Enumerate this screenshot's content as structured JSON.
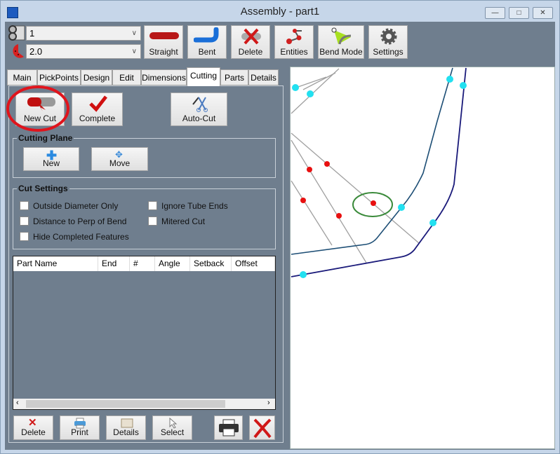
{
  "window": {
    "title": "Assembly - part1",
    "minimize": "—",
    "restore": "□",
    "close": "✕"
  },
  "toolbar": {
    "tube_select": {
      "value": "1"
    },
    "radius_select": {
      "value": "2.0"
    },
    "buttons": [
      {
        "label": "Straight",
        "icon": "straight-tube-icon"
      },
      {
        "label": "Bent",
        "icon": "bent-tube-icon"
      },
      {
        "label": "Delete",
        "icon": "delete-tube-icon"
      },
      {
        "label": "Entities",
        "icon": "entities-icon"
      },
      {
        "label": "Bend Mode",
        "icon": "bend-mode-icon"
      },
      {
        "label": "Settings",
        "icon": "gear-icon"
      }
    ]
  },
  "tabs": [
    {
      "label": "Main"
    },
    {
      "label": "PickPoints"
    },
    {
      "label": "Design"
    },
    {
      "label": "Edit"
    },
    {
      "label": "Dimensions"
    },
    {
      "label": "Cutting",
      "active": true
    },
    {
      "label": "Parts"
    },
    {
      "label": "Details"
    }
  ],
  "cutting": {
    "new_cut": "New Cut",
    "complete": "Complete",
    "auto_cut": "Auto-Cut",
    "cutting_plane": {
      "title": "Cutting Plane",
      "new": "New",
      "move": "Move"
    },
    "cut_settings": {
      "title": "Cut Settings",
      "options": [
        {
          "label": "Outside Diameter Only",
          "checked": false
        },
        {
          "label": "Ignore Tube Ends",
          "checked": false
        },
        {
          "label": "Distance to Perp of Bend",
          "checked": false
        },
        {
          "label": "Mitered Cut",
          "checked": false
        },
        {
          "label": "Hide Completed Features",
          "checked": false
        }
      ]
    },
    "table": {
      "columns": [
        "Part Name",
        "End",
        "#",
        "Angle",
        "Setback",
        "Offset"
      ],
      "rows": []
    },
    "bottom": {
      "delete": "Delete",
      "print": "Print",
      "details": "Details",
      "select": "Select"
    }
  },
  "colors": {
    "highlight_circle": "#e0141c",
    "cyan_point": "#22e0f0",
    "red_point": "#e81010",
    "selection_ellipse": "#3a8a3a",
    "tube_outer": "#1a1a7a",
    "tube_inner": "#1d4e75"
  }
}
